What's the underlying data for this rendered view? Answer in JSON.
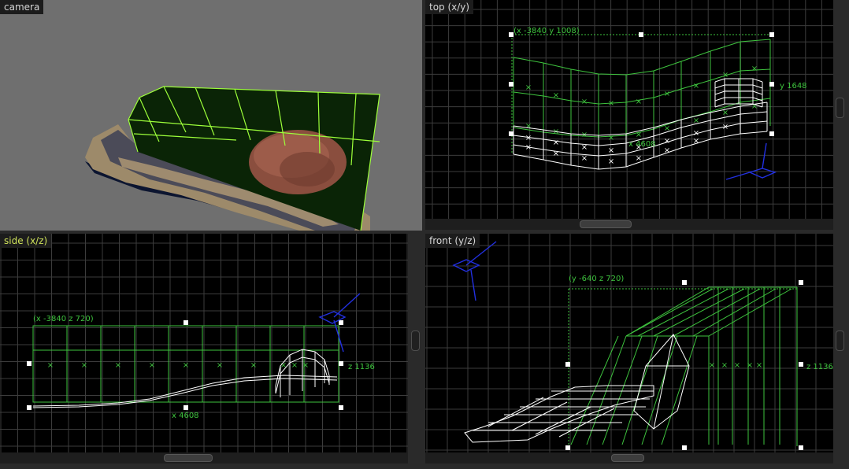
{
  "viewports": {
    "camera": {
      "label": "camera"
    },
    "top": {
      "label": "top (x/y)",
      "corner_coord": "(x -3840 y 1008)",
      "side_dim": "y 1648",
      "width_dim": "x 4608"
    },
    "side": {
      "label": "side (x/z)",
      "corner_coord": "(x -3840 z 720)",
      "side_dim": "z 1136",
      "width_dim": "x 4608"
    },
    "front": {
      "label": "front (y/z)",
      "corner_coord": "(y -640 z 720)",
      "side_dim": "z 1136"
    }
  },
  "colors": {
    "grid": "#3c3c3c",
    "brush_selected": "#3ec43e",
    "patch_mesh": "#ffffff",
    "camera_gizmo": "#2230e0",
    "camera_sky": "#6f6f6f",
    "wall_fill": "#0a2406",
    "wall_edge": "#9dff3a"
  },
  "icons": [
    "camera-gizmo-icon",
    "selection-handle-icon",
    "brush-center-x-icon"
  ]
}
